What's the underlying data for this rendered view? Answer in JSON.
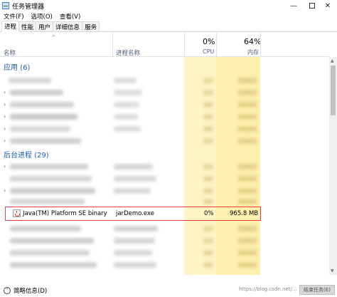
{
  "window": {
    "title": "任务管理器",
    "controls": {
      "minimize": "—",
      "close": "✕"
    }
  },
  "menu": {
    "items": [
      "文件(F)",
      "选项(O)",
      "查看(V)"
    ]
  },
  "tabs": [
    "进程",
    "性能",
    "用户",
    "详细信息",
    "服务"
  ],
  "header": {
    "name_label": "名称",
    "process_label": "进程名称",
    "cpu_pct": "0%",
    "cpu_label": "CPU",
    "mem_pct": "64%",
    "mem_label": "内存",
    "sort_indicator": "^"
  },
  "sections": {
    "apps": "应用 (6)",
    "background": "后台进程 (29)"
  },
  "highlighted_row": {
    "name": "Java(TM) Platform SE binary",
    "process": "jarDemo.exe",
    "cpu": "0%",
    "memory": "965.8 MB"
  },
  "status": {
    "label": "简略信息(D)",
    "collapse_icon": "⌃",
    "end_task_button": "结束任务(E)",
    "watermark": "https://blog.csdn.net/..."
  },
  "icons": {
    "chevron": "›",
    "scroll_up": "▲",
    "scroll_down": "▼"
  }
}
